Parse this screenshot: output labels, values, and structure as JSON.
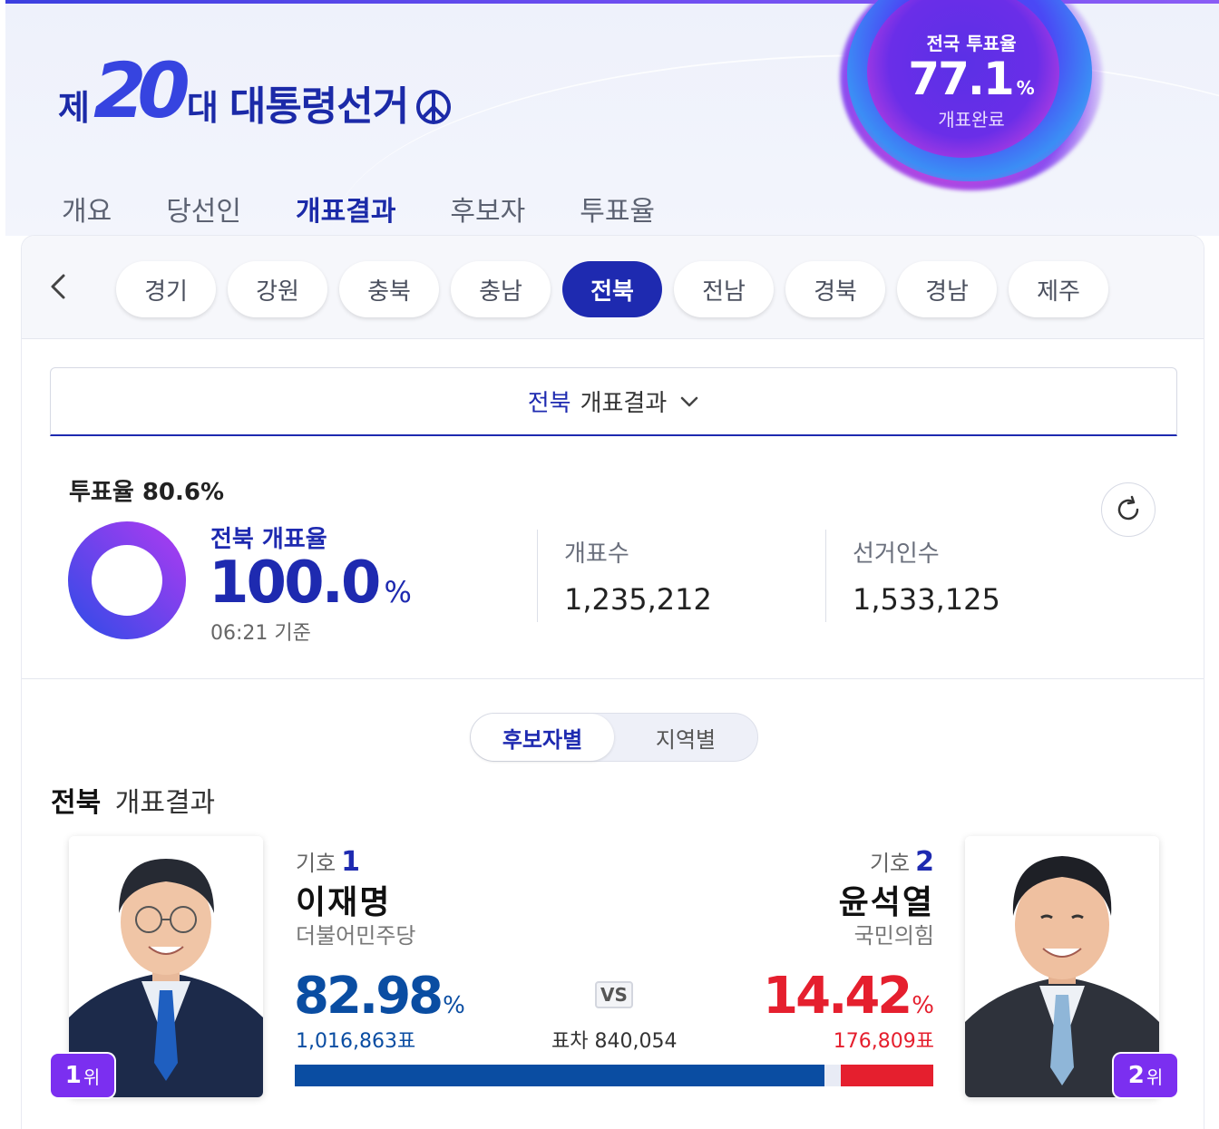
{
  "header": {
    "logo_prefix": "제",
    "logo_number": "20",
    "logo_suffix": "대",
    "logo_title": "대통령선거"
  },
  "national_turnout": {
    "label": "전국 투표율",
    "value": "77.1",
    "unit": "%",
    "status": "개표완료"
  },
  "nav": {
    "tabs": [
      {
        "label": "개요"
      },
      {
        "label": "당선인"
      },
      {
        "label": "개표결과",
        "active": true
      },
      {
        "label": "후보자"
      },
      {
        "label": "투표율"
      }
    ]
  },
  "regions": {
    "items": [
      "경기",
      "강원",
      "충북",
      "충남",
      "전북",
      "전남",
      "경북",
      "경남",
      "제주"
    ],
    "selected": "전북"
  },
  "dropdown": {
    "region": "전북",
    "label": "개표결과"
  },
  "summary": {
    "turnout_label": "투표율",
    "turnout_value": "80.6%",
    "count_rate_label": "전북 개표율",
    "count_rate_value": "100.0",
    "count_rate_unit": "%",
    "count_rate_fraction": 1.0,
    "time": "06:21 기준",
    "counted_label": "개표수",
    "counted_value": "1,235,212",
    "electorate_label": "선거인수",
    "electorate_value": "1,533,125"
  },
  "view_toggle": {
    "options": [
      "후보자별",
      "지역별"
    ],
    "selected": "후보자별"
  },
  "results": {
    "title_region": "전북",
    "title_text": "개표결과",
    "vs_label": "VS",
    "margin_text": "표차 840,054",
    "candidates": [
      {
        "number_label": "기호",
        "number": "1",
        "name": "이재명",
        "party": "더불어민주당",
        "percent": "82.98",
        "percent_unit": "%",
        "votes": "1,016,863표",
        "rank": "1",
        "rank_unit": "위",
        "color": "#0a4da2",
        "share": 82.98
      },
      {
        "number_label": "기호",
        "number": "2",
        "name": "윤석열",
        "party": "국민의힘",
        "percent": "14.42",
        "percent_unit": "%",
        "votes": "176,809표",
        "rank": "2",
        "rank_unit": "위",
        "color": "#e51f2e",
        "share": 14.42
      }
    ]
  },
  "colors": {
    "brand_navy": "#1e2ab0",
    "accent_purple": "#7b2ff0",
    "party_1": "#0a4da2",
    "party_2": "#e51f2e"
  }
}
